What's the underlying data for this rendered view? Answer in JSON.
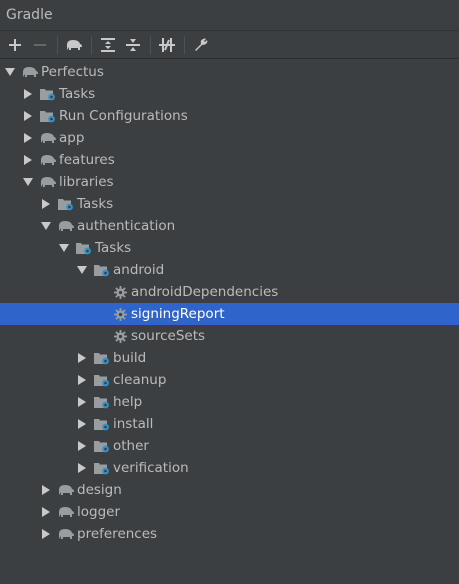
{
  "panel": {
    "title": "Gradle"
  },
  "tree": [
    {
      "label": "Perfectus",
      "icon": "gradle-elephant-icon",
      "level": 0,
      "expanded": true
    },
    {
      "label": "Tasks",
      "icon": "tasks-folder-icon",
      "level": 1,
      "expanded": false
    },
    {
      "label": "Run Configurations",
      "icon": "tasks-folder-icon",
      "level": 1,
      "expanded": false
    },
    {
      "label": "app",
      "icon": "gradle-elephant-icon",
      "level": 1,
      "expanded": false
    },
    {
      "label": "features",
      "icon": "gradle-elephant-icon",
      "level": 1,
      "expanded": false
    },
    {
      "label": "libraries",
      "icon": "gradle-elephant-icon",
      "level": 1,
      "expanded": true
    },
    {
      "label": "Tasks",
      "icon": "tasks-folder-icon",
      "level": 2,
      "expanded": false
    },
    {
      "label": "authentication",
      "icon": "gradle-elephant-icon",
      "level": 2,
      "expanded": true
    },
    {
      "label": "Tasks",
      "icon": "tasks-folder-icon",
      "level": 3,
      "expanded": true
    },
    {
      "label": "android",
      "icon": "tasks-folder-icon",
      "level": 4,
      "expanded": true
    },
    {
      "label": "androidDependencies",
      "icon": "task-gear-icon",
      "level": 5,
      "leaf": true
    },
    {
      "label": "signingReport",
      "icon": "task-gear-icon",
      "level": 5,
      "leaf": true,
      "selected": true
    },
    {
      "label": "sourceSets",
      "icon": "task-gear-icon",
      "level": 5,
      "leaf": true
    },
    {
      "label": "build",
      "icon": "tasks-folder-icon",
      "level": 4,
      "expanded": false
    },
    {
      "label": "cleanup",
      "icon": "tasks-folder-icon",
      "level": 4,
      "expanded": false
    },
    {
      "label": "help",
      "icon": "tasks-folder-icon",
      "level": 4,
      "expanded": false
    },
    {
      "label": "install",
      "icon": "tasks-folder-icon",
      "level": 4,
      "expanded": false
    },
    {
      "label": "other",
      "icon": "tasks-folder-icon",
      "level": 4,
      "expanded": false
    },
    {
      "label": "verification",
      "icon": "tasks-folder-icon",
      "level": 4,
      "expanded": false
    },
    {
      "label": "design",
      "icon": "gradle-elephant-icon",
      "level": 2,
      "expanded": false
    },
    {
      "label": "logger",
      "icon": "gradle-elephant-icon",
      "level": 2,
      "expanded": false
    },
    {
      "label": "preferences",
      "icon": "gradle-elephant-icon",
      "level": 2,
      "expanded": false
    }
  ],
  "colors": {
    "background": "#3c3f41",
    "selection": "#2f65ca",
    "text": "#bbbbbb",
    "icon_gray": "#9a9da0",
    "icon_blue": "#3592c4"
  }
}
